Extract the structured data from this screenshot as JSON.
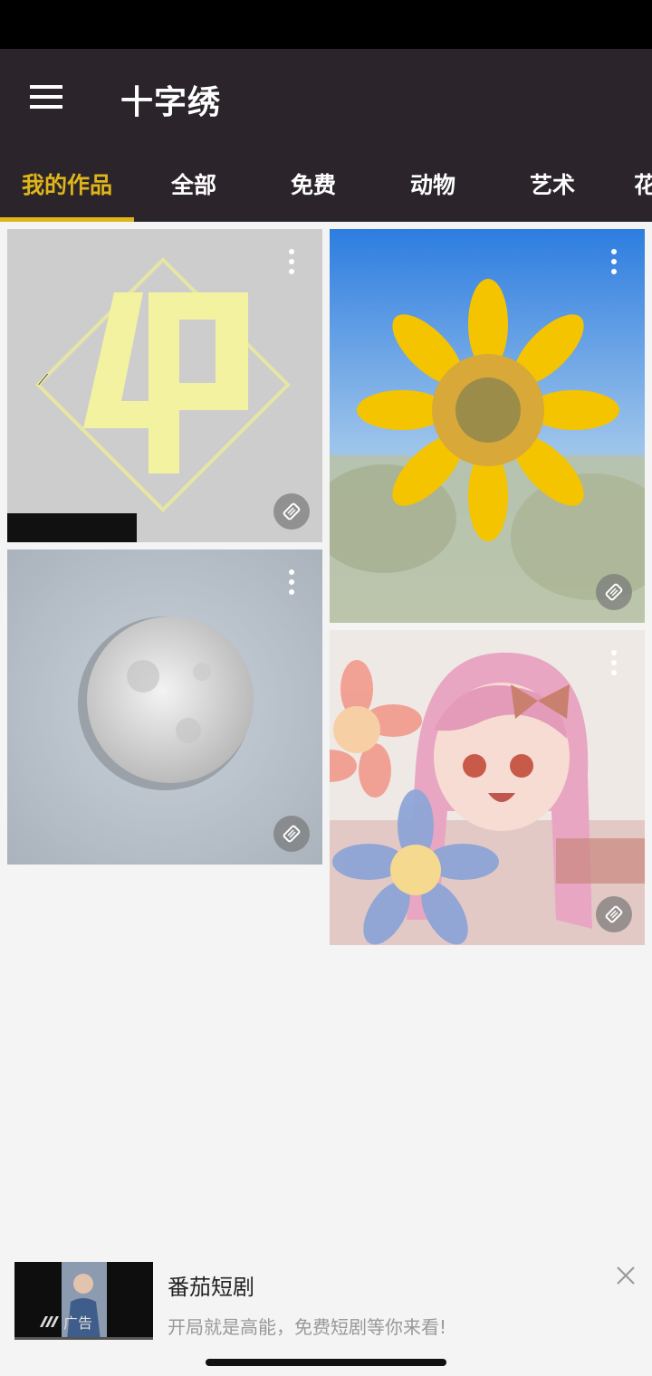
{
  "app": {
    "title": "十字绣"
  },
  "tabs": [
    {
      "label": "我的作品"
    },
    {
      "label": "全部"
    },
    {
      "label": "免费"
    },
    {
      "label": "动物"
    },
    {
      "label": "艺术"
    },
    {
      "label": "花"
    }
  ],
  "artworks": [
    {
      "name": "4P logo"
    },
    {
      "name": "sunflower"
    },
    {
      "name": "moon"
    },
    {
      "name": "anime girl with flowers"
    }
  ],
  "ad": {
    "title": "番茄短剧",
    "subtitle": "开局就是高能，免费短剧等你来看!",
    "badge": "广告"
  },
  "colors": {
    "app_bar": "#2b252b",
    "accent": "#e0b51a",
    "background": "#f4f4f4"
  }
}
